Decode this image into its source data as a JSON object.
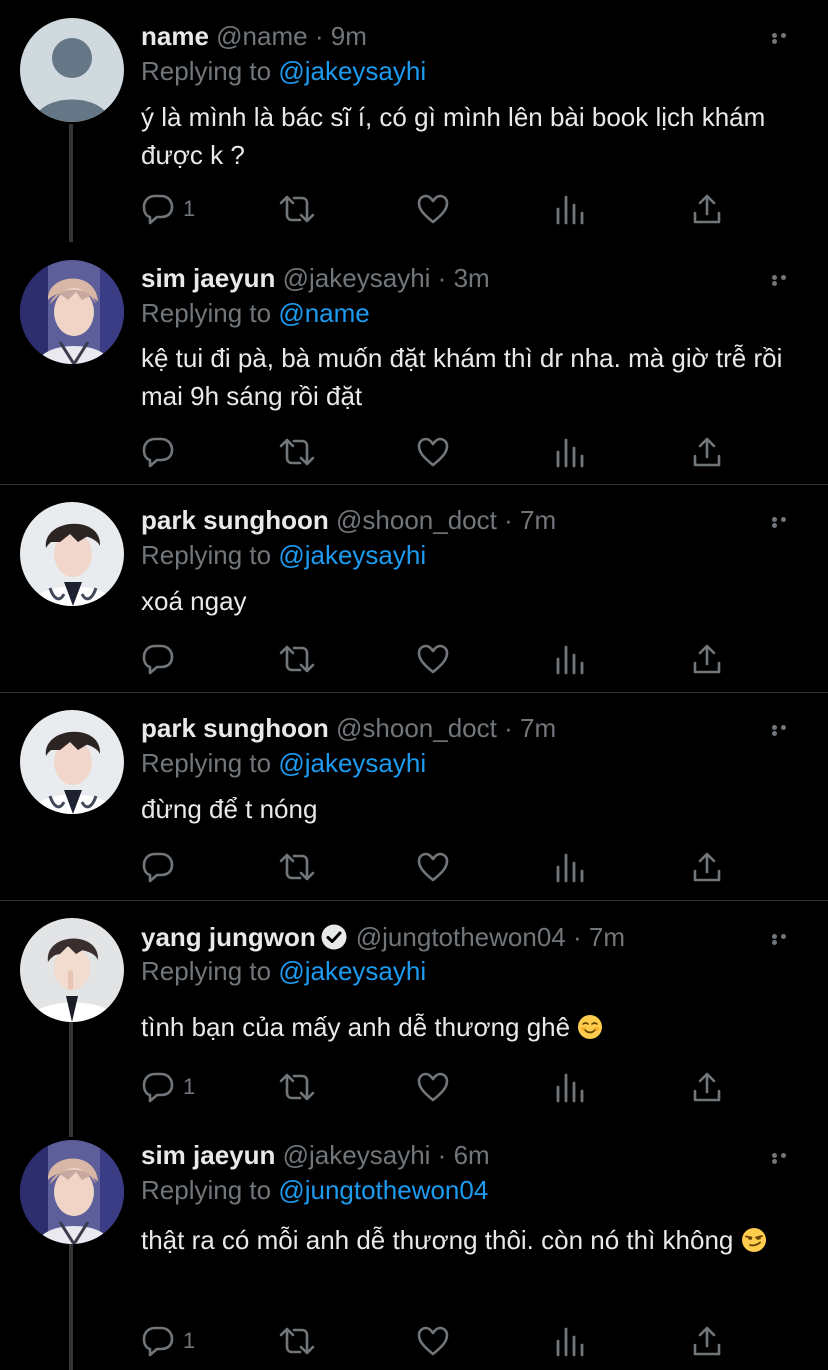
{
  "thread": [
    {
      "name": "name",
      "handle": "@name",
      "dot": "·",
      "time": "9m",
      "replying_label": "Replying to",
      "replying_to": "@jakeysayhi",
      "text": "ý là mình là bác sĩ í, có gì mình lên bài book lịch khám được k ?",
      "reply_count": "1",
      "avatar": "default-avatar",
      "verified": false
    },
    {
      "name": "sim jaeyun",
      "handle": "@jakeysayhi",
      "dot": "·",
      "time": "3m",
      "replying_label": "Replying to",
      "replying_to": "@name",
      "text": "kệ tui đi pà, bà muốn đặt khám thì dr nha. mà giờ trễ rồi mai 9h sáng rồi đặt",
      "reply_count": "",
      "avatar": "photo-avatar-blonde",
      "verified": false
    },
    {
      "name": "park sunghoon",
      "handle": "@shoon_doct",
      "dot": "·",
      "time": "7m",
      "replying_label": "Replying to",
      "replying_to": "@jakeysayhi",
      "text": "xoá ngay",
      "reply_count": "",
      "avatar": "photo-avatar-doctor",
      "verified": false
    },
    {
      "name": "park sunghoon",
      "handle": "@shoon_doct",
      "dot": "·",
      "time": "7m",
      "replying_label": "Replying to",
      "replying_to": "@jakeysayhi",
      "text": "đừng để t nóng",
      "reply_count": "",
      "avatar": "photo-avatar-doctor",
      "verified": false
    },
    {
      "name": "yang jungwon",
      "handle": "@jungtothewon04",
      "dot": "·",
      "time": "7m",
      "replying_label": "Replying to",
      "replying_to": "@jakeysayhi",
      "text": "tình bạn của mấy anh dễ thương ghê",
      "emoji": "smiling-face-emoji",
      "reply_count": "1",
      "avatar": "photo-avatar-shush",
      "verified": true
    },
    {
      "name": "sim jaeyun",
      "handle": "@jakeysayhi",
      "dot": "·",
      "time": "6m",
      "replying_label": "Replying to",
      "replying_to": "@jungtothewon04",
      "text": "thật ra có mỗi anh dễ thương thôi. còn nó thì không",
      "emoji": "smirking-face-emoji",
      "reply_count": "1",
      "avatar": "photo-avatar-blonde",
      "verified": false
    }
  ],
  "icons": {
    "reply": "reply-icon",
    "retweet": "retweet-icon",
    "like": "like-icon",
    "analytics": "analytics-icon",
    "share": "share-icon",
    "more": "more-icon"
  },
  "colors": {
    "background": "#000000",
    "accent": "#1d9bf0",
    "muted": "#71767b",
    "text": "#e7e9ea"
  }
}
